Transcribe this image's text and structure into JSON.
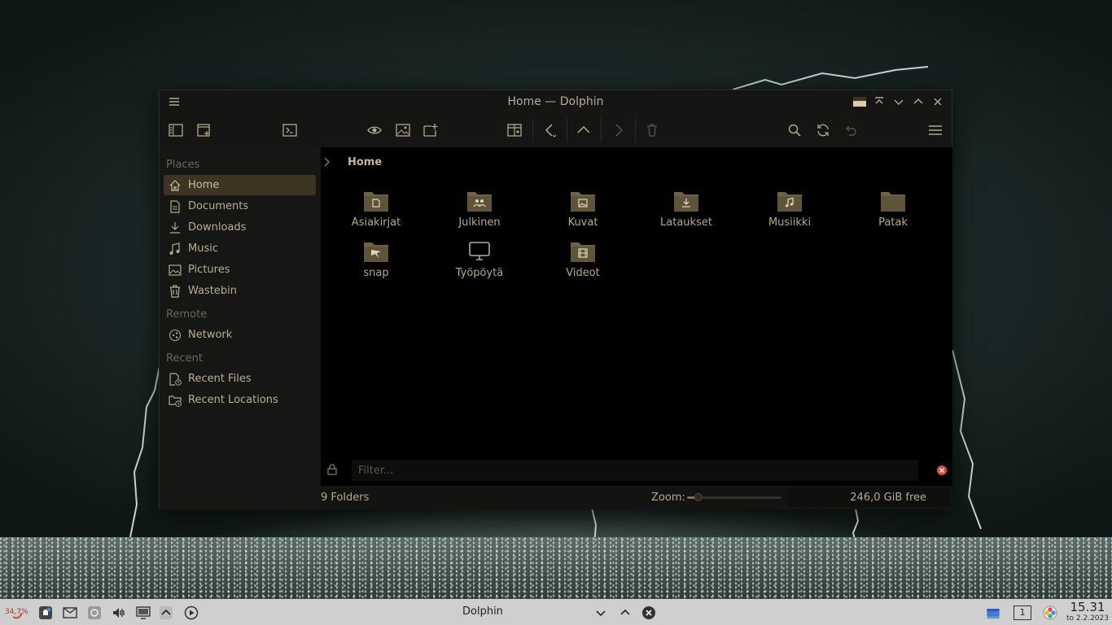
{
  "window": {
    "title": "Home — Dolphin"
  },
  "sidebar": {
    "sections": [
      {
        "label": "Places",
        "items": [
          {
            "label": "Home",
            "icon": "home-icon",
            "active": true
          },
          {
            "label": "Documents",
            "icon": "documents-icon"
          },
          {
            "label": "Downloads",
            "icon": "downloads-icon"
          },
          {
            "label": "Music",
            "icon": "music-icon"
          },
          {
            "label": "Pictures",
            "icon": "pictures-icon"
          },
          {
            "label": "Wastebin",
            "icon": "trash-icon"
          }
        ]
      },
      {
        "label": "Remote",
        "items": [
          {
            "label": "Network",
            "icon": "network-icon"
          }
        ]
      },
      {
        "label": "Recent",
        "items": [
          {
            "label": "Recent Files",
            "icon": "recent-files-icon"
          },
          {
            "label": "Recent Locations",
            "icon": "recent-locations-icon"
          }
        ]
      }
    ]
  },
  "breadcrumb": {
    "current": "Home"
  },
  "folders": [
    {
      "label": "Asiakirjat",
      "icon": "documents-folder-icon"
    },
    {
      "label": "Julkinen",
      "icon": "public-folder-icon"
    },
    {
      "label": "Kuvat",
      "icon": "pictures-folder-icon"
    },
    {
      "label": "Lataukset",
      "icon": "downloads-folder-icon"
    },
    {
      "label": "Musiikki",
      "icon": "music-folder-icon"
    },
    {
      "label": "Patak",
      "icon": "folder-icon"
    },
    {
      "label": "snap",
      "icon": "snap-folder-icon"
    },
    {
      "label": "Työpöytä",
      "icon": "desktop-icon"
    },
    {
      "label": "Videot",
      "icon": "videos-folder-icon"
    }
  ],
  "filter": {
    "placeholder": "Filter..."
  },
  "status": {
    "summary": "9 Folders",
    "zoom_label": "Zoom:",
    "zoom_level": 0.12,
    "free_space": "246,0 GiB free"
  },
  "taskbar": {
    "battery": "34,7%",
    "active_task": "Dolphin",
    "desktop_number": "1",
    "time": "15.31",
    "date": "to 2.2.2023"
  },
  "colors": {
    "accent": "#3d3424",
    "folder": "#6e6245",
    "text": "#b5a98d",
    "taskbar": "#cfcfcf",
    "close_red": "#e04848"
  }
}
